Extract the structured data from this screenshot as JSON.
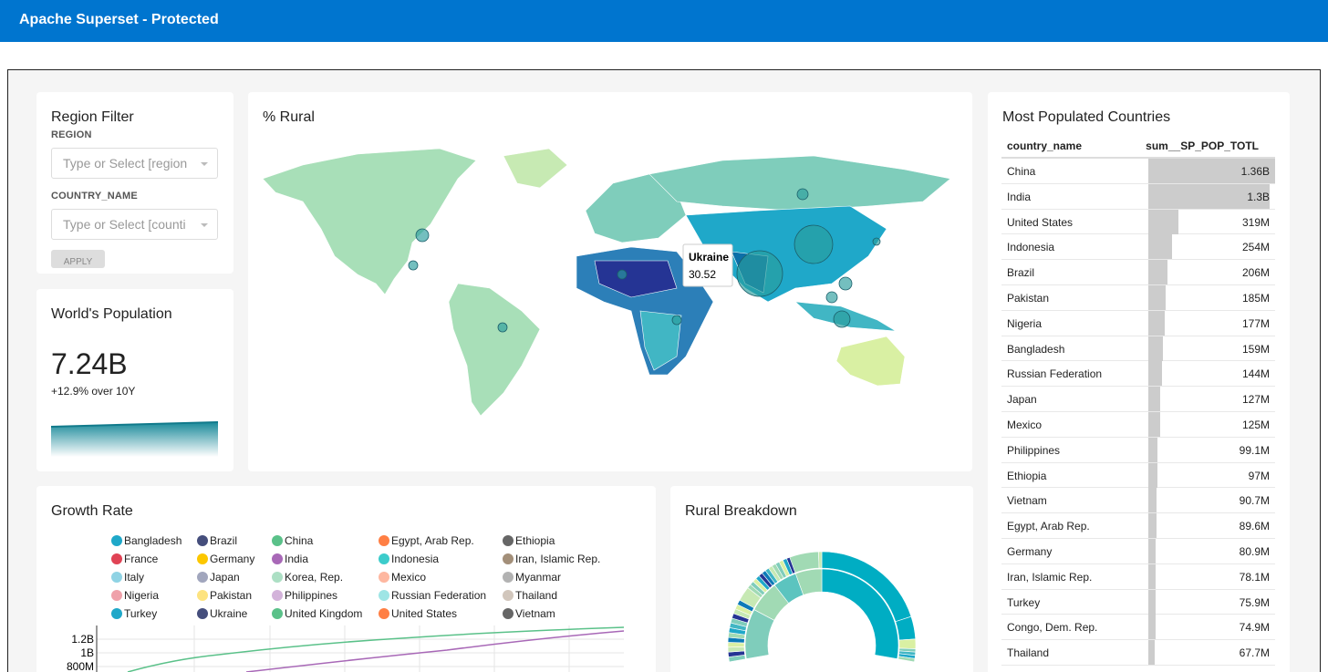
{
  "header": {
    "title": "Apache Superset - Protected"
  },
  "filter": {
    "title": "Region Filter",
    "region_label": "REGION",
    "region_placeholder": "Type or Select [region",
    "country_label": "COUNTRY_NAME",
    "country_placeholder": "Type or Select [counti",
    "apply": "APPLY"
  },
  "world": {
    "title": "World's Population",
    "value": "7.24B",
    "delta": "+12.9% over 10Y"
  },
  "map": {
    "title": "% Rural",
    "tooltip_country": "Ukraine",
    "tooltip_value": "30.52"
  },
  "table": {
    "title": "Most Populated Countries",
    "col1": "country_name",
    "col2": "sum__SP_POP_TOTL",
    "rows": [
      {
        "name": "China",
        "value": "1.36B",
        "num": 1.36
      },
      {
        "name": "India",
        "value": "1.3B",
        "num": 1.3
      },
      {
        "name": "United States",
        "value": "319M",
        "num": 0.319
      },
      {
        "name": "Indonesia",
        "value": "254M",
        "num": 0.254
      },
      {
        "name": "Brazil",
        "value": "206M",
        "num": 0.206
      },
      {
        "name": "Pakistan",
        "value": "185M",
        "num": 0.185
      },
      {
        "name": "Nigeria",
        "value": "177M",
        "num": 0.177
      },
      {
        "name": "Bangladesh",
        "value": "159M",
        "num": 0.159
      },
      {
        "name": "Russian Federation",
        "value": "144M",
        "num": 0.144
      },
      {
        "name": "Japan",
        "value": "127M",
        "num": 0.127
      },
      {
        "name": "Mexico",
        "value": "125M",
        "num": 0.125
      },
      {
        "name": "Philippines",
        "value": "99.1M",
        "num": 0.0991
      },
      {
        "name": "Ethiopia",
        "value": "97M",
        "num": 0.097
      },
      {
        "name": "Vietnam",
        "value": "90.7M",
        "num": 0.0907
      },
      {
        "name": "Egypt, Arab Rep.",
        "value": "89.6M",
        "num": 0.0896
      },
      {
        "name": "Germany",
        "value": "80.9M",
        "num": 0.0809
      },
      {
        "name": "Iran, Islamic Rep.",
        "value": "78.1M",
        "num": 0.0781
      },
      {
        "name": "Turkey",
        "value": "75.9M",
        "num": 0.0759
      },
      {
        "name": "Congo, Dem. Rep.",
        "value": "74.9M",
        "num": 0.0749
      },
      {
        "name": "Thailand",
        "value": "67.7M",
        "num": 0.0677
      }
    ]
  },
  "growth": {
    "title": "Growth Rate",
    "legend": [
      {
        "name": "Bangladesh",
        "color": "#1fa8c9"
      },
      {
        "name": "Brazil",
        "color": "#454e7c"
      },
      {
        "name": "China",
        "color": "#5ac189"
      },
      {
        "name": "Egypt, Arab Rep.",
        "color": "#ff7f44"
      },
      {
        "name": "Ethiopia",
        "color": "#666666"
      },
      {
        "name": "France",
        "color": "#e04355"
      },
      {
        "name": "Germany",
        "color": "#fcc700"
      },
      {
        "name": "India",
        "color": "#a868b7"
      },
      {
        "name": "Indonesia",
        "color": "#3cccCB"
      },
      {
        "name": "Iran, Islamic Rep.",
        "color": "#a38f79"
      },
      {
        "name": "Italy",
        "color": "#8fd3e4"
      },
      {
        "name": "Japan",
        "color": "#a1a6bd"
      },
      {
        "name": "Korea, Rep.",
        "color": "#acdfc4"
      },
      {
        "name": "Mexico",
        "color": "#feb7a0"
      },
      {
        "name": "Myanmar",
        "color": "#b2b2b2"
      },
      {
        "name": "Nigeria",
        "color": "#efa1aa"
      },
      {
        "name": "Pakistan",
        "color": "#fde380"
      },
      {
        "name": "Philippines",
        "color": "#d3b3da"
      },
      {
        "name": "Russian Federation",
        "color": "#9ee5e5"
      },
      {
        "name": "Thailand",
        "color": "#d1c6bc"
      },
      {
        "name": "Turkey",
        "color": "#1fa8c9"
      },
      {
        "name": "Ukraine",
        "color": "#454e7c"
      },
      {
        "name": "United Kingdom",
        "color": "#5ac189"
      },
      {
        "name": "United States",
        "color": "#ff7f44"
      },
      {
        "name": "Vietnam",
        "color": "#666666"
      }
    ],
    "yticks": [
      "1.2B",
      "1B",
      "800M"
    ]
  },
  "rural": {
    "title": "Rural Breakdown"
  }
}
